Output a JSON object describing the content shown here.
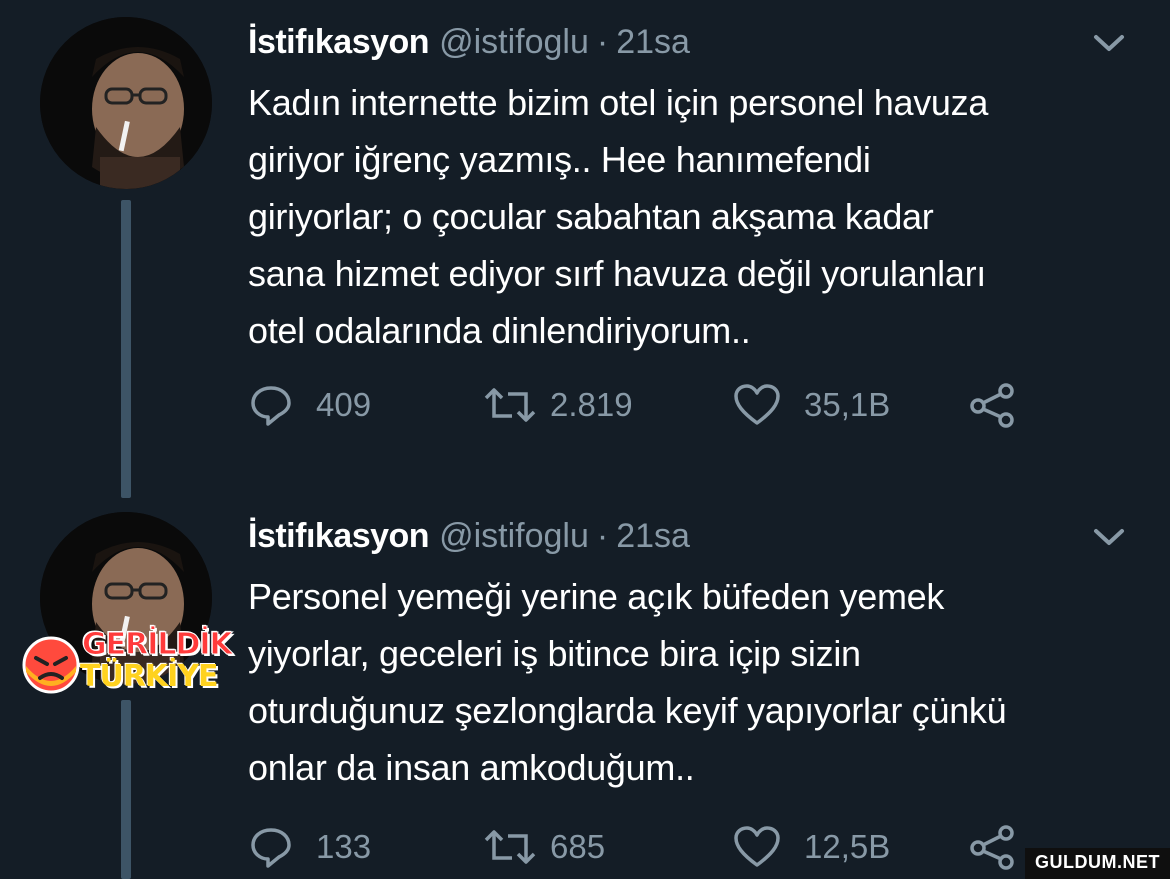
{
  "tweets": [
    {
      "name": "İstifıkasyon",
      "handle": "@istifoglu",
      "separator": "·",
      "time": "21sa",
      "text": "Kadın internette bizim otel için personel havuza\ngiriyor iğrenç yazmış.. Hee hanımefendi\ngiriyorlar; o çocular sabahtan akşama kadar\nsana hizmet ediyor sırf havuza değil yorulanları\notel odalarında dinlendiriyorum..",
      "replies": "409",
      "retweets": "2.819",
      "likes": "35,1B"
    },
    {
      "name": "İstifıkasyon",
      "handle": "@istifoglu",
      "separator": "·",
      "time": "21sa",
      "text": "Personel yemeği yerine açık büfeden yemek\nyiyorlar, geceleri iş bitince bira içip sizin\noturduğunuz şezlonglarda keyif yapıyorlar çünkü\nonlar da insan amkoduğum..",
      "replies": "133",
      "retweets": "685",
      "likes": "12,5B"
    }
  ],
  "badge": {
    "line1": "GERİLDİK",
    "line2": "TÜRKİYE"
  },
  "watermark": "GULDUM.NET",
  "icons": {
    "reply": "reply-icon",
    "retweet": "retweet-icon",
    "like": "heart-icon",
    "share": "share-icon",
    "menu": "chevron-down-icon"
  },
  "colors": {
    "background": "#141d26",
    "secondary_text": "#8899a6",
    "thread_line": "#3d5466"
  }
}
